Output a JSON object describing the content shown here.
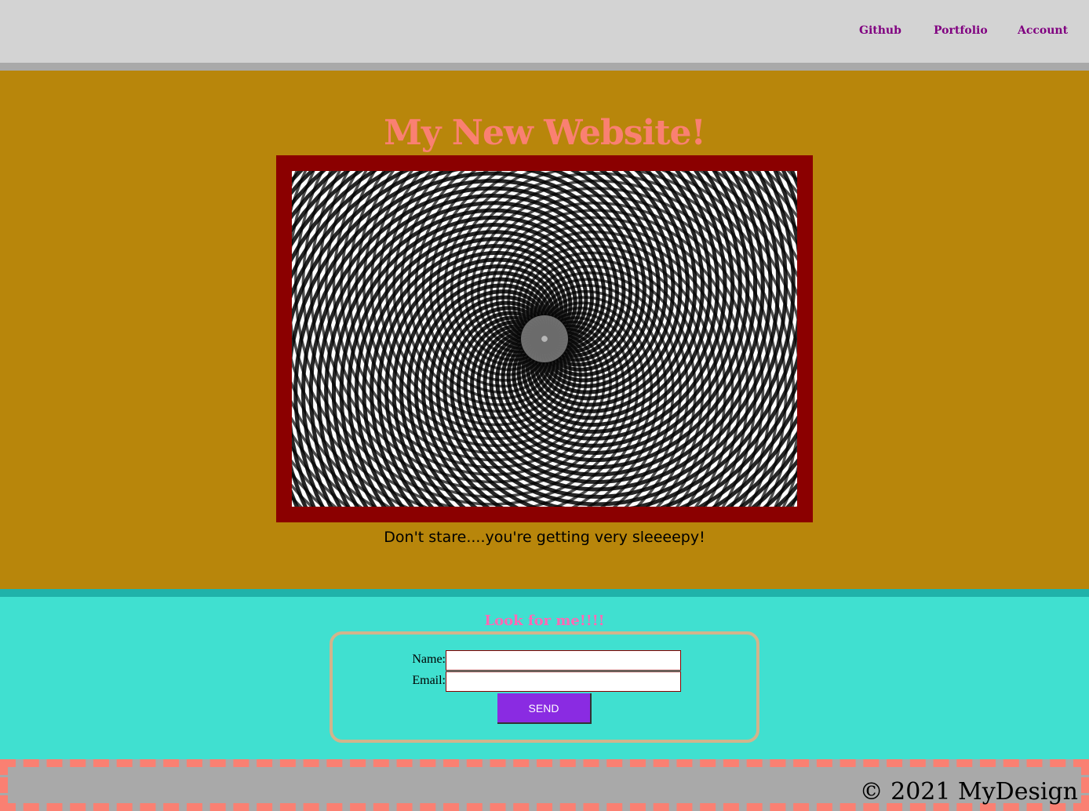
{
  "nav": {
    "links": [
      "Github",
      "Portfolio",
      "Account"
    ]
  },
  "hero": {
    "title": "My New Website!",
    "caption": "Don't stare....you're getting very sleeeepy!"
  },
  "contact": {
    "heading": "Look for me!!!!",
    "name_label": "Name:",
    "email_label": "Email:",
    "name_value": "",
    "email_value": "",
    "send_label": "SEND"
  },
  "footer": {
    "text": "© 2021 MyDesign"
  },
  "colors": {
    "nav_bg": "#d3d3d3",
    "nav_link": "#800080",
    "hero_bg": "#b8860b",
    "title": "#fa8072",
    "frame": "#8b0000",
    "contact_bg": "#40e0d0",
    "heading": "#ff69b4",
    "send_bg": "#8a2be2",
    "footer_bg": "#a9a9a9",
    "footer_dash": "#fa8072"
  }
}
